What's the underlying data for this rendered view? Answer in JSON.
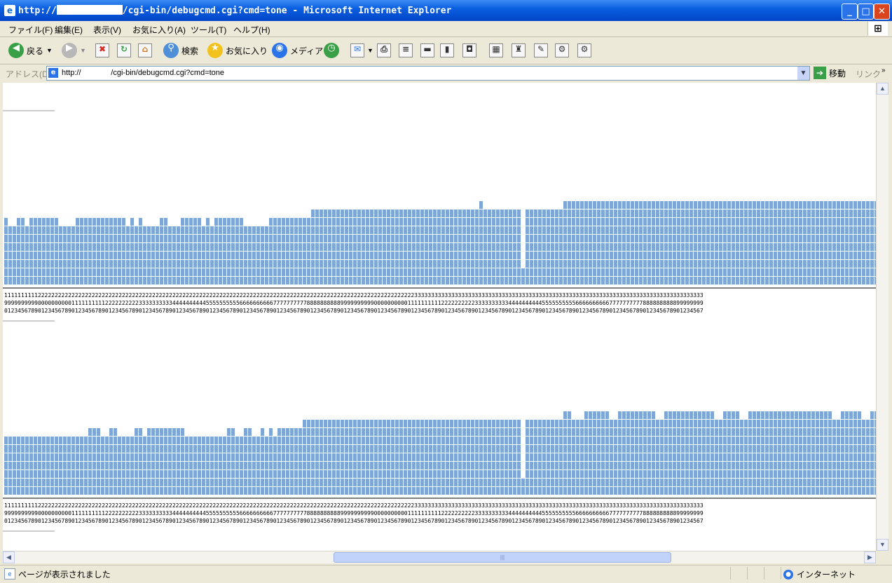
{
  "window": {
    "title_prefix": "http://",
    "title_suffix": "/cgi-bin/debugcmd.cgi?cmd=tone - Microsoft Internet Explorer",
    "minimize": "_",
    "maximize": "□",
    "close": "✕"
  },
  "menu": [
    "ファイル(F)",
    "編集(E)",
    "表示(V)",
    "お気に入り(A)",
    "ツール(T)",
    "ヘルプ(H)"
  ],
  "toolbar": {
    "back": "戻る",
    "search": "検索",
    "favorites": "お気に入り",
    "media": "メディア"
  },
  "address": {
    "label": "アドレス(D)",
    "url": "http://              /cgi-bin/debugcmd.cgi?cmd=tone",
    "go": "移動",
    "links": "リンク"
  },
  "status": {
    "text": "ページが表示されました",
    "zone": "インターネット"
  },
  "chart_data": [
    {
      "type": "bar",
      "x": [
        1,
        2,
        3,
        4,
        5,
        6,
        7,
        8,
        9,
        10,
        11,
        12,
        13,
        14,
        15,
        16,
        17,
        18,
        19,
        20,
        21,
        22,
        23,
        24,
        25,
        26,
        27,
        28,
        29,
        30,
        31,
        32,
        33,
        34,
        35,
        36,
        37,
        38,
        39,
        40,
        41,
        42,
        43,
        44,
        45,
        46,
        47,
        48,
        49,
        50,
        51,
        52,
        53,
        54,
        55,
        56,
        57,
        58,
        59,
        60,
        61,
        62,
        63,
        64,
        65,
        66,
        67,
        68,
        69,
        70,
        71,
        72,
        73,
        74,
        75,
        76,
        77,
        78,
        79,
        80,
        81,
        82,
        83,
        84,
        85,
        86,
        87,
        88,
        89,
        90,
        91,
        92,
        93,
        94,
        95,
        96,
        97,
        98,
        99,
        100,
        101,
        102,
        103,
        104,
        105,
        106,
        107,
        108,
        109,
        110,
        111,
        112,
        113,
        114,
        115,
        116,
        117,
        118,
        119,
        120,
        121,
        122,
        123,
        124,
        125,
        126,
        127,
        128,
        129,
        130,
        131,
        132,
        133,
        134,
        135,
        136,
        137,
        138,
        139,
        140,
        141,
        142,
        143,
        144,
        145,
        146,
        147,
        148,
        149,
        150,
        151,
        152,
        153,
        154,
        155,
        156,
        157,
        158,
        159,
        160,
        161,
        162,
        163,
        164,
        165,
        166,
        167,
        168,
        169,
        170,
        171,
        172,
        173,
        174,
        175,
        176,
        177,
        178,
        179,
        180,
        181,
        182,
        183,
        184,
        185,
        186,
        187,
        188,
        189,
        190,
        191,
        192,
        193,
        194,
        195,
        196,
        197,
        198,
        199,
        200,
        201,
        202,
        203,
        204,
        205,
        206,
        207
      ],
      "values": [
        8,
        7,
        7,
        8,
        8,
        7,
        8,
        8,
        8,
        8,
        8,
        8,
        8,
        7,
        7,
        7,
        7,
        8,
        8,
        8,
        8,
        8,
        8,
        8,
        8,
        8,
        8,
        8,
        8,
        7,
        8,
        7,
        8,
        7,
        7,
        7,
        7,
        8,
        8,
        7,
        7,
        7,
        8,
        8,
        8,
        8,
        8,
        7,
        8,
        7,
        8,
        8,
        8,
        8,
        8,
        8,
        8,
        7,
        7,
        7,
        7,
        7,
        7,
        8,
        8,
        8,
        8,
        8,
        8,
        8,
        8,
        8,
        8,
        9,
        9,
        9,
        9,
        9,
        9,
        9,
        9,
        9,
        9,
        9,
        9,
        9,
        9,
        9,
        9,
        9,
        9,
        9,
        9,
        9,
        9,
        9,
        9,
        9,
        9,
        9,
        9,
        9,
        9,
        9,
        9,
        9,
        9,
        9,
        9,
        9,
        9,
        9,
        9,
        10,
        9,
        9,
        9,
        9,
        9,
        9,
        9,
        9,
        9,
        2,
        9,
        9,
        9,
        9,
        9,
        9,
        9,
        9,
        9,
        10,
        10,
        10,
        10,
        10,
        10,
        10,
        10,
        10,
        10,
        10,
        10,
        10,
        10,
        10,
        10,
        10,
        10,
        10,
        10,
        10,
        10,
        10,
        10,
        10,
        10,
        10,
        10,
        10,
        10,
        10,
        10,
        10,
        10,
        10,
        10,
        10,
        10,
        10,
        10,
        10,
        10,
        10,
        10,
        10,
        10,
        10,
        10,
        10,
        10,
        10,
        10,
        10,
        10,
        10,
        10,
        10,
        10,
        10,
        10,
        10,
        10,
        10,
        10,
        10,
        10,
        10,
        10,
        10,
        10,
        10,
        10,
        10,
        10,
        10,
        10,
        10,
        10,
        10
      ],
      "x_tick_labels": {
        "tens": "1111111111222222222222222222222222222222222222222222222222222222222222222222222222222222222222222222222222222222222222222233333333333333333333333333333333333333333333333333333333333333333333333333333333333333",
        "ones": "9999999999000000000011111111112222222222333333333344444444445555555555666666666677777777778888888888999999999900000000001111111111222222222233333333334444444444555555555566666666667777777777888888888899999999",
        "units": "0123456789012345678901234567890123456789012345678901234567890123456789012345678901234567890123456789012345678901234567890123456789012345678901234567890123456789012345678901234567890123456789012345678901234567"
      }
    },
    {
      "type": "bar",
      "x": [
        1,
        2,
        3,
        4,
        5,
        6,
        7,
        8,
        9,
        10,
        11,
        12,
        13,
        14,
        15,
        16,
        17,
        18,
        19,
        20,
        21,
        22,
        23,
        24,
        25,
        26,
        27,
        28,
        29,
        30,
        31,
        32,
        33,
        34,
        35,
        36,
        37,
        38,
        39,
        40,
        41,
        42,
        43,
        44,
        45,
        46,
        47,
        48,
        49,
        50,
        51,
        52,
        53,
        54,
        55,
        56,
        57,
        58,
        59,
        60,
        61,
        62,
        63,
        64,
        65,
        66,
        67,
        68,
        69,
        70,
        71,
        72,
        73,
        74,
        75,
        76,
        77,
        78,
        79,
        80,
        81,
        82,
        83,
        84,
        85,
        86,
        87,
        88,
        89,
        90,
        91,
        92,
        93,
        94,
        95,
        96,
        97,
        98,
        99,
        100,
        101,
        102,
        103,
        104,
        105,
        106,
        107,
        108,
        109,
        110,
        111,
        112,
        113,
        114,
        115,
        116,
        117,
        118,
        119,
        120,
        121,
        122,
        123,
        124,
        125,
        126,
        127,
        128,
        129,
        130,
        131,
        132,
        133,
        134,
        135,
        136,
        137,
        138,
        139,
        140,
        141,
        142,
        143,
        144,
        145,
        146,
        147,
        148,
        149,
        150,
        151,
        152,
        153,
        154,
        155,
        156,
        157,
        158,
        159,
        160,
        161,
        162,
        163,
        164,
        165,
        166,
        167,
        168,
        169,
        170,
        171,
        172,
        173,
        174,
        175,
        176,
        177,
        178,
        179,
        180,
        181,
        182,
        183,
        184,
        185,
        186,
        187,
        188,
        189,
        190,
        191,
        192,
        193,
        194,
        195,
        196,
        197,
        198,
        199,
        200,
        201,
        202,
        203,
        204,
        205,
        206,
        207
      ],
      "values": [
        7,
        7,
        7,
        7,
        7,
        7,
        7,
        7,
        7,
        7,
        7,
        7,
        7,
        7,
        7,
        7,
        7,
        7,
        7,
        7,
        8,
        8,
        8,
        7,
        7,
        8,
        8,
        7,
        7,
        7,
        7,
        8,
        8,
        7,
        8,
        8,
        8,
        8,
        8,
        8,
        8,
        8,
        8,
        7,
        7,
        7,
        7,
        7,
        7,
        7,
        7,
        7,
        7,
        8,
        8,
        7,
        7,
        8,
        8,
        7,
        7,
        8,
        7,
        8,
        7,
        8,
        8,
        8,
        8,
        8,
        8,
        9,
        9,
        9,
        9,
        9,
        9,
        9,
        9,
        9,
        9,
        9,
        9,
        9,
        9,
        9,
        9,
        9,
        9,
        9,
        9,
        9,
        9,
        9,
        9,
        9,
        9,
        9,
        9,
        9,
        9,
        9,
        9,
        9,
        9,
        9,
        9,
        9,
        9,
        9,
        9,
        9,
        9,
        9,
        9,
        9,
        9,
        9,
        9,
        9,
        9,
        9,
        9,
        2,
        9,
        9,
        9,
        9,
        9,
        9,
        9,
        9,
        9,
        10,
        10,
        9,
        9,
        9,
        10,
        10,
        10,
        10,
        10,
        10,
        9,
        9,
        10,
        10,
        10,
        10,
        10,
        10,
        10,
        10,
        10,
        9,
        9,
        10,
        10,
        10,
        10,
        10,
        10,
        10,
        10,
        10,
        10,
        10,
        10,
        9,
        9,
        10,
        10,
        10,
        10,
        9,
        9,
        10,
        10,
        10,
        10,
        10,
        10,
        10,
        10,
        10,
        10,
        10,
        10,
        10,
        10,
        10,
        10,
        10,
        10,
        10,
        10,
        9,
        9,
        10,
        10,
        10,
        10,
        10,
        9,
        9,
        10,
        10,
        9,
        9,
        9,
        9,
        9
      ],
      "x_tick_labels": {
        "tens": "1111111111222222222222222222222222222222222222222222222222222222222222222222222222222222222222222222222222222222222222222233333333333333333333333333333333333333333333333333333333333333333333333333333333333333",
        "ones": "9999999999000000000011111111112222222222333333333344444444445555555555666666666677777777778888888888999999999900000000001111111111222222222233333333334444444444555555555566666666667777777777888888888899999999",
        "units": "0123456789012345678901234567890123456789012345678901234567890123456789012345678901234567890123456789012345678901234567890123456789012345678901234567890123456789012345678901234567890123456789012345678901234567"
      }
    }
  ],
  "colors": {
    "bar": "#7ea6d6",
    "gap": "#ffffff",
    "titlebar": "#0a5fe0"
  }
}
